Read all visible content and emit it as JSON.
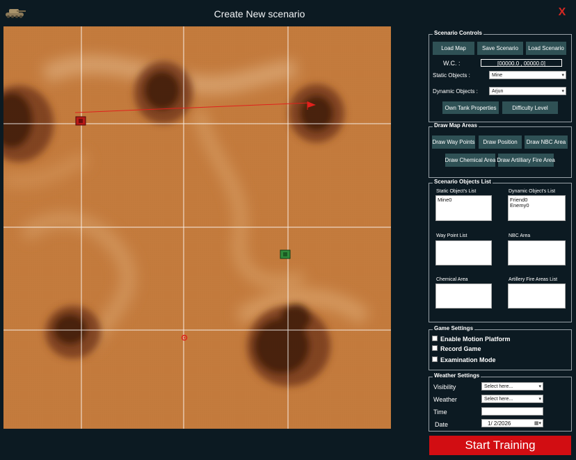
{
  "window": {
    "title": "Create New scenario",
    "close_label": "X"
  },
  "scenario_controls": {
    "legend": "Scenario Controls",
    "load_map": "Load Map",
    "save_scenario": "Save Scenario",
    "load_scenario": "Load Scenario",
    "wc_label": "W.C. :",
    "wc_value": "[00000.0 , 00000.0]",
    "static_label": "Static Objects :",
    "static_value": "Mine",
    "dynamic_label": "Dynamic Objects :",
    "dynamic_value": "Arjun",
    "own_tank": "Own Tank Properties",
    "difficulty": "Difficulty Level"
  },
  "draw_map_areas": {
    "legend": "Draw Map Areas",
    "way_points": "Draw Way Points",
    "position": "Draw Position",
    "nbc": "Draw NBC Area",
    "chemical": "Draw Chemical Area",
    "artillery": "Draw Artilliary Fire Area"
  },
  "objects_list": {
    "legend": "Scenario Objects List",
    "static_list_label": "Static Object's List",
    "static_items": [
      "Mine0"
    ],
    "dynamic_list_label": "Dynamic Object's List",
    "dynamic_items": [
      "Friend0",
      "Enemy0"
    ],
    "way_point_label": "Way Point List",
    "nbc_label": "NBC Area",
    "chemical_label": "Chemical Area",
    "artillery_label": "Artillery Fire Areas List"
  },
  "game_settings": {
    "legend": "Game Settings",
    "motion": "Enable Motion Platform",
    "record": "Record Game",
    "exam": "Examination Mode"
  },
  "weather": {
    "legend": "Weather Settings",
    "visibility_label": "Visibility",
    "visibility_value": "Select here...",
    "weather_label": "Weather",
    "weather_value": "Select here...",
    "time_label": "Time",
    "time_value": "",
    "date_label": "Date",
    "date_value": "1/  2/2026"
  },
  "start_training": "Start Training",
  "colors": {
    "accent_button": "#2f5155",
    "start": "#d20d12",
    "terrain": "#c07a3c",
    "background": "#0c1a22"
  }
}
